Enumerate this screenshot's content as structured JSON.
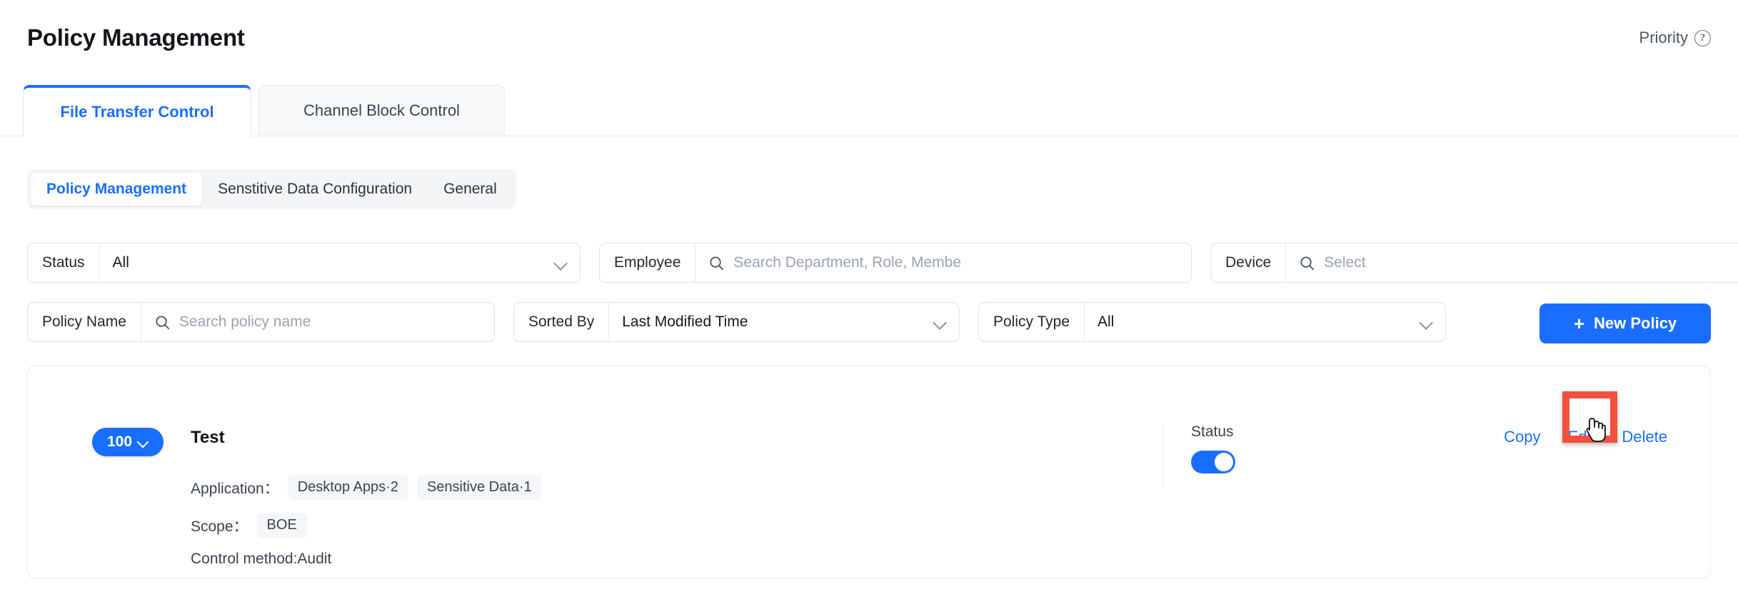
{
  "header": {
    "title": "Policy Management",
    "priority_label": "Priority",
    "help_icon": "question-circle-icon"
  },
  "tabs": [
    {
      "label": "File Transfer Control",
      "active": true
    },
    {
      "label": "Channel Block Control",
      "active": false
    }
  ],
  "sub_tabs": [
    {
      "label": "Policy Management",
      "active": true
    },
    {
      "label": "Senstitive Data Configuration",
      "active": false
    },
    {
      "label": "General",
      "active": false
    }
  ],
  "filters": {
    "status": {
      "label": "Status",
      "value": "All",
      "icon": "chevron-down-icon"
    },
    "employee": {
      "label": "Employee",
      "placeholder": "Search Department, Role, Membe",
      "icon": "search-icon"
    },
    "device": {
      "label": "Device",
      "placeholder": "Select",
      "icon": "search-icon"
    },
    "policy_name": {
      "label": "Policy Name",
      "placeholder": "Search policy name",
      "icon": "search-icon"
    },
    "sorted_by": {
      "label": "Sorted By",
      "value": "Last Modified Time",
      "icon": "chevron-down-icon"
    },
    "policy_type": {
      "label": "Policy Type",
      "value": "All",
      "icon": "chevron-down-icon"
    }
  },
  "new_policy_button": {
    "label": "New Policy",
    "icon": "plus-icon"
  },
  "policy": {
    "priority": "100",
    "priority_icon": "chevron-down-icon",
    "name": "Test",
    "application_label": "Application：",
    "application_tags": [
      "Desktop Apps·2",
      "Sensitive Data·1"
    ],
    "scope_label": "Scope：",
    "scope_tags": [
      "BOE"
    ],
    "control_method": "Control method:Audit",
    "status_label": "Status",
    "status_on": true,
    "actions": [
      "Copy",
      "Edit",
      "Delete"
    ]
  },
  "annotation": {
    "highlight_target": "Edit",
    "highlight_color": "#f4503c",
    "cursor": "pointer-hand-cursor"
  }
}
